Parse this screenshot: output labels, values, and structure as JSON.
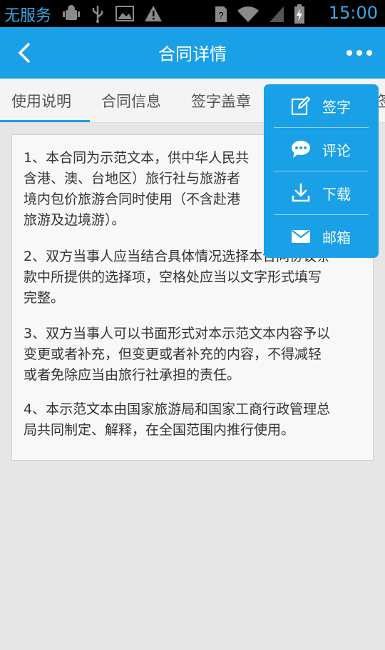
{
  "status_bar": {
    "carrier": "无服务",
    "time": "15:00",
    "icons_left": [
      "android-debug-icon",
      "usb-icon",
      "image-icon",
      "warning-icon"
    ],
    "icons_right": [
      "sim-unknown-icon",
      "wifi-icon",
      "signal-icon",
      "battery-charging-icon"
    ]
  },
  "app_bar": {
    "title": "合同详情",
    "back_icon": "back-arrow-icon",
    "more_icon": "more-dots-icon"
  },
  "tabs": [
    {
      "label": "使用说明",
      "active": true
    },
    {
      "label": "合同信息",
      "active": false
    },
    {
      "label": "签字盖章",
      "active": false
    },
    {
      "label": "签",
      "active": false
    }
  ],
  "content": {
    "paragraphs": [
      {
        "lines": [
          "1、本合同为示范文本，供中华人民共",
          "含港、澳、台地区）旅行社与旅游者",
          "境内包价旅游合同时使用（不含赴港",
          "旅游及边境游）。"
        ]
      },
      {
        "lines": [
          "2、双方当事人应当结合具体情况选择本合同协议条",
          "款中所提供的选择项，空格处应当以文字形式填写",
          "完整。"
        ]
      },
      {
        "lines": [
          "3、双方当事人可以书面形式对本示范文本内容予以",
          "变更或者补充，但变更或者补充的内容，不得减轻",
          "或者免除应当由旅行社承担的责任。"
        ]
      },
      {
        "lines": [
          "4、本示范文本由国家旅游局和国家工商行政管理总",
          "局共同制定、解释，在全国范围内推行使用。"
        ]
      }
    ]
  },
  "popup_menu": {
    "items": [
      {
        "label": "签字",
        "icon": "edit-sign-icon"
      },
      {
        "label": "评论",
        "icon": "comment-bubble-icon"
      },
      {
        "label": "下载",
        "icon": "download-icon"
      },
      {
        "label": "邮箱",
        "icon": "mail-icon"
      }
    ]
  },
  "colors": {
    "accent": "#1aa0e6",
    "status_text": "#3aa8e8",
    "body_text": "#333333",
    "background": "#e6e6e6"
  }
}
